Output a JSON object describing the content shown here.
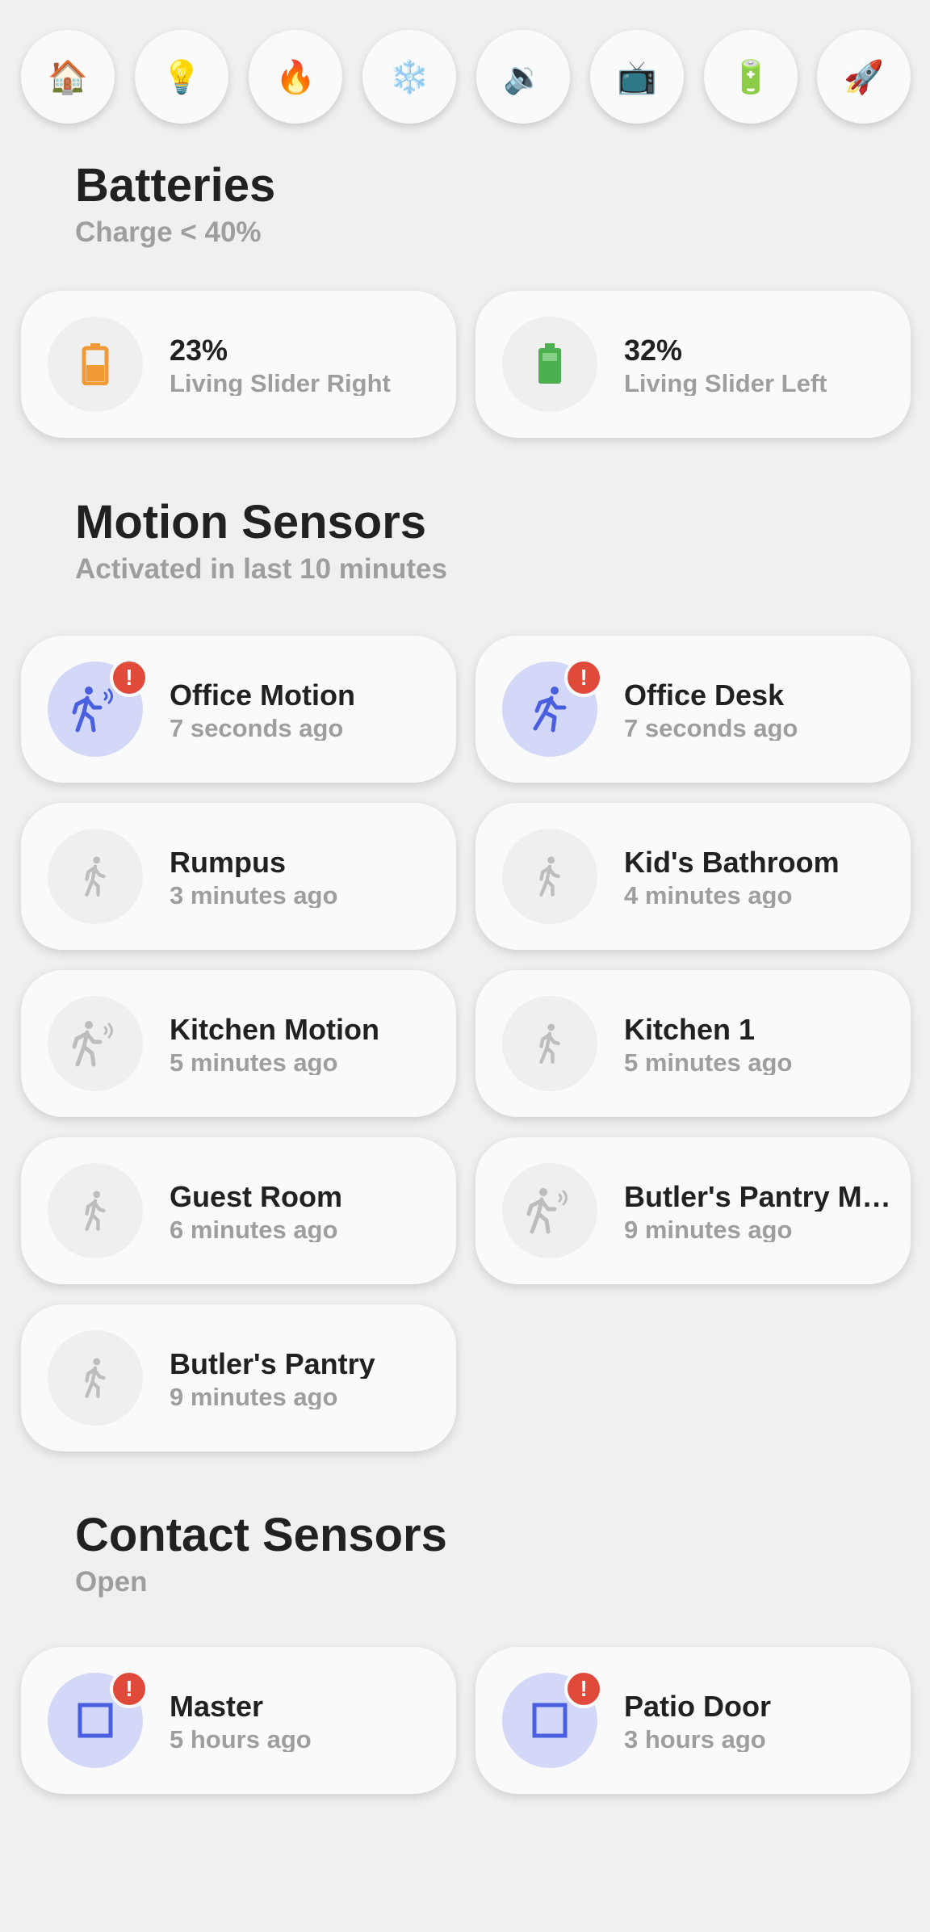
{
  "nav": {
    "buttons": [
      {
        "glyph": "🏠",
        "icon": "home-icon"
      },
      {
        "glyph": "💡",
        "icon": "lightbulb-icon"
      },
      {
        "glyph": "🔥",
        "icon": "fire-icon"
      },
      {
        "glyph": "❄️",
        "icon": "snowflake-icon"
      },
      {
        "glyph": "🔉",
        "icon": "speaker-icon"
      },
      {
        "glyph": "📺",
        "icon": "tv-icon"
      },
      {
        "glyph": "🔋",
        "icon": "battery-icon"
      },
      {
        "glyph": "🚀",
        "icon": "rocket-icon"
      }
    ]
  },
  "batteries": {
    "title": "Batteries",
    "subtitle": "Charge < 40%",
    "cards": [
      {
        "value": "23%",
        "name": "Living Slider Right",
        "icon": "battery-low-icon",
        "color": "#f09a37"
      },
      {
        "value": "32%",
        "name": "Living Slider Left",
        "icon": "battery-icon",
        "color": "#4caf50"
      }
    ]
  },
  "motion": {
    "title": "Motion Sensors",
    "subtitle": "Activated in last 10 minutes",
    "cards": [
      {
        "name": "Office Motion",
        "time": "7 seconds ago",
        "active": true,
        "icon": "motion-sensor-icon"
      },
      {
        "name": "Office Desk",
        "time": "7 seconds ago",
        "active": true,
        "icon": "run-icon"
      },
      {
        "name": "Rumpus",
        "time": "3 minutes ago",
        "active": false,
        "icon": "walk-icon"
      },
      {
        "name": "Kid's Bathroom",
        "time": "4 minutes ago",
        "active": false,
        "icon": "walk-icon"
      },
      {
        "name": "Kitchen Motion",
        "time": "5 minutes ago",
        "active": false,
        "icon": "motion-sensor-icon"
      },
      {
        "name": "Kitchen 1",
        "time": "5 minutes ago",
        "active": false,
        "icon": "walk-icon"
      },
      {
        "name": "Guest Room",
        "time": "6 minutes ago",
        "active": false,
        "icon": "walk-icon"
      },
      {
        "name": "Butler's Pantry Motion",
        "time": "9 minutes ago",
        "active": false,
        "icon": "motion-sensor-icon"
      },
      {
        "name": "Butler's Pantry",
        "time": "9 minutes ago",
        "active": false,
        "icon": "walk-icon"
      }
    ]
  },
  "contact": {
    "title": "Contact Sensors",
    "subtitle": "Open",
    "cards": [
      {
        "name": "Master",
        "time": "5 hours ago",
        "active": true,
        "icon": "door-open-icon"
      },
      {
        "name": "Patio Door",
        "time": "3 hours ago",
        "active": true,
        "icon": "door-open-icon"
      }
    ]
  },
  "alert_badge": "!",
  "colors": {
    "active_icon": "#4a5fe0",
    "active_bg": "#d3d8f8",
    "inactive_icon": "#bdbdbd",
    "badge": "#e04a3b"
  }
}
